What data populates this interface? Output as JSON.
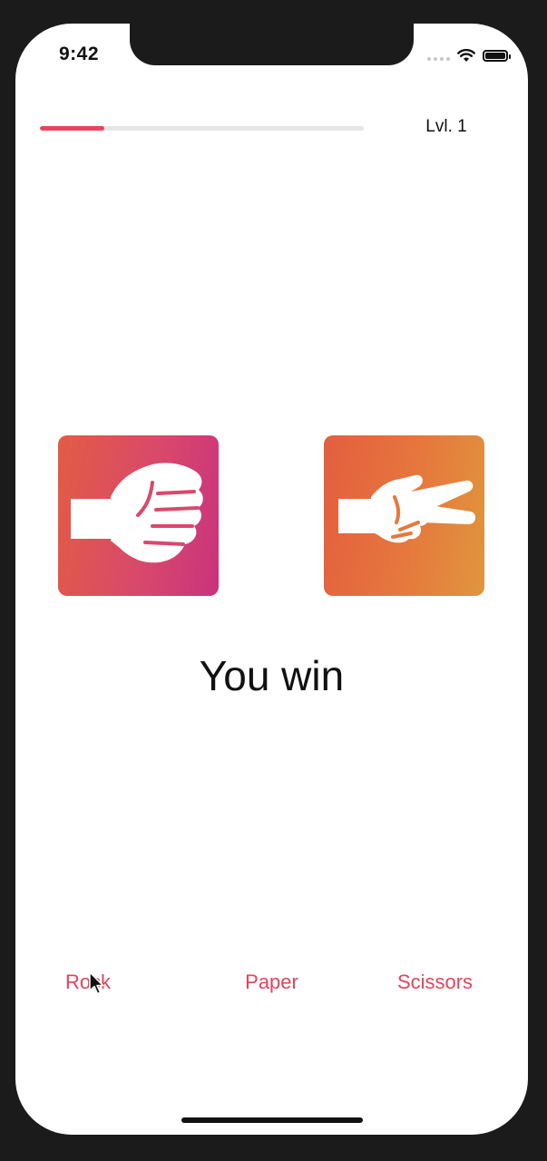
{
  "status_bar": {
    "time": "9:42",
    "icons": [
      "signal-icon",
      "wifi-icon",
      "battery-icon"
    ]
  },
  "header": {
    "level_label": "Lvl. 1",
    "progress_fraction": 0.2
  },
  "game": {
    "player_hand": "rock-fist-icon",
    "opponent_hand": "scissors-peace-icon",
    "result": "You win"
  },
  "choices": {
    "rock": "Rock",
    "paper": "Paper",
    "scissors": "Scissors"
  },
  "colors": {
    "accent": "#e2445e",
    "card_left_start": "#e35c43",
    "card_left_end": "#c9337c",
    "card_right_start": "#e35e3f",
    "card_right_end": "#e0963d"
  }
}
